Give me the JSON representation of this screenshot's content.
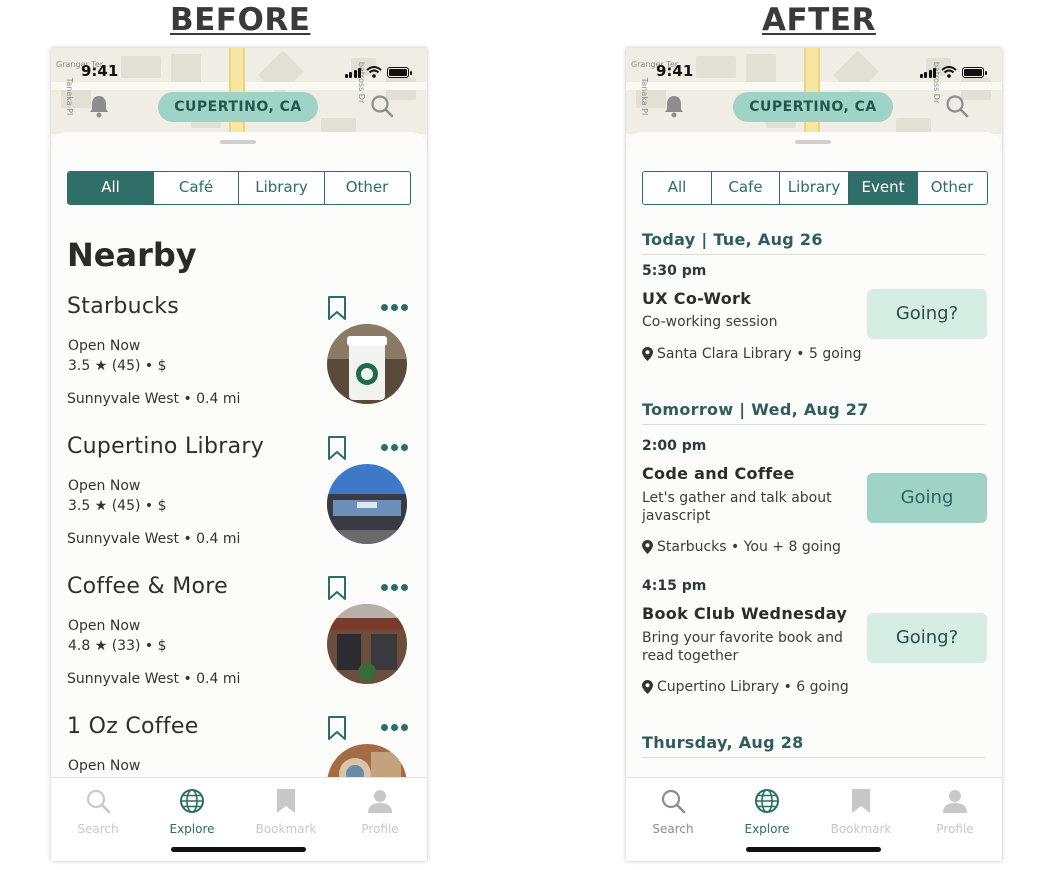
{
  "labels": {
    "before": "BEFORE",
    "after": "AFTER"
  },
  "status": {
    "time": "9:41"
  },
  "map_streets": {
    "granger": "Granger Ter",
    "tanaka": "Tanaka Pl",
    "albatross": "batross Dr"
  },
  "location": "CUPERTINO, CA",
  "before": {
    "filters": [
      "All",
      "Café",
      "Library",
      "Other"
    ],
    "active_filter": "All",
    "section_title": "Nearby",
    "places": [
      {
        "name": "Starbucks",
        "status": "Open Now",
        "rating": "3.5 ★ (45) • $",
        "area": "Sunnyvale West  • 0.4 mi"
      },
      {
        "name": "Cupertino Library",
        "status": "Open Now",
        "rating": "3.5 ★ (45) • $",
        "area": "Sunnyvale West  • 0.4 mi"
      },
      {
        "name": "Coffee & More",
        "status": "Open Now",
        "rating": "4.8 ★ (33) • $",
        "area": "Sunnyvale West  • 0.4 mi"
      },
      {
        "name": "1 Oz Coffee",
        "status": "Open Now",
        "rating": "",
        "area": ""
      }
    ]
  },
  "after": {
    "filters": [
      "All",
      "Cafe",
      "Library",
      "Event",
      "Other"
    ],
    "active_filter": "Event",
    "days": [
      {
        "heading": "Today | Tue, Aug 26"
      },
      {
        "heading": "Tomorrow | Wed, Aug 27"
      },
      {
        "heading": "Thursday, Aug 28"
      }
    ],
    "events": [
      {
        "time": "5:30 pm",
        "title": "UX Co-Work",
        "desc": "Co-working session",
        "location": "Santa Clara Library • 5 going",
        "button": "Going?",
        "going": false
      },
      {
        "time": "2:00 pm",
        "title": "Code and Coffee",
        "desc": "Let's gather and talk about javascript",
        "location": "Starbucks • You + 8 going",
        "button": "Going",
        "going": true
      },
      {
        "time": "4:15 pm",
        "title": "Book Club Wednesday",
        "desc": "Bring your favorite book and read together",
        "location": "Cupertino Library • 6 going",
        "button": "Going?",
        "going": false
      }
    ]
  },
  "tabs": [
    "Search",
    "Explore",
    "Bookmark",
    "Profile"
  ],
  "active_tab": "Explore",
  "colors": {
    "accent": "#2c6d66",
    "pill": "#9fd3c5",
    "going_bg": "#d6ede4"
  }
}
